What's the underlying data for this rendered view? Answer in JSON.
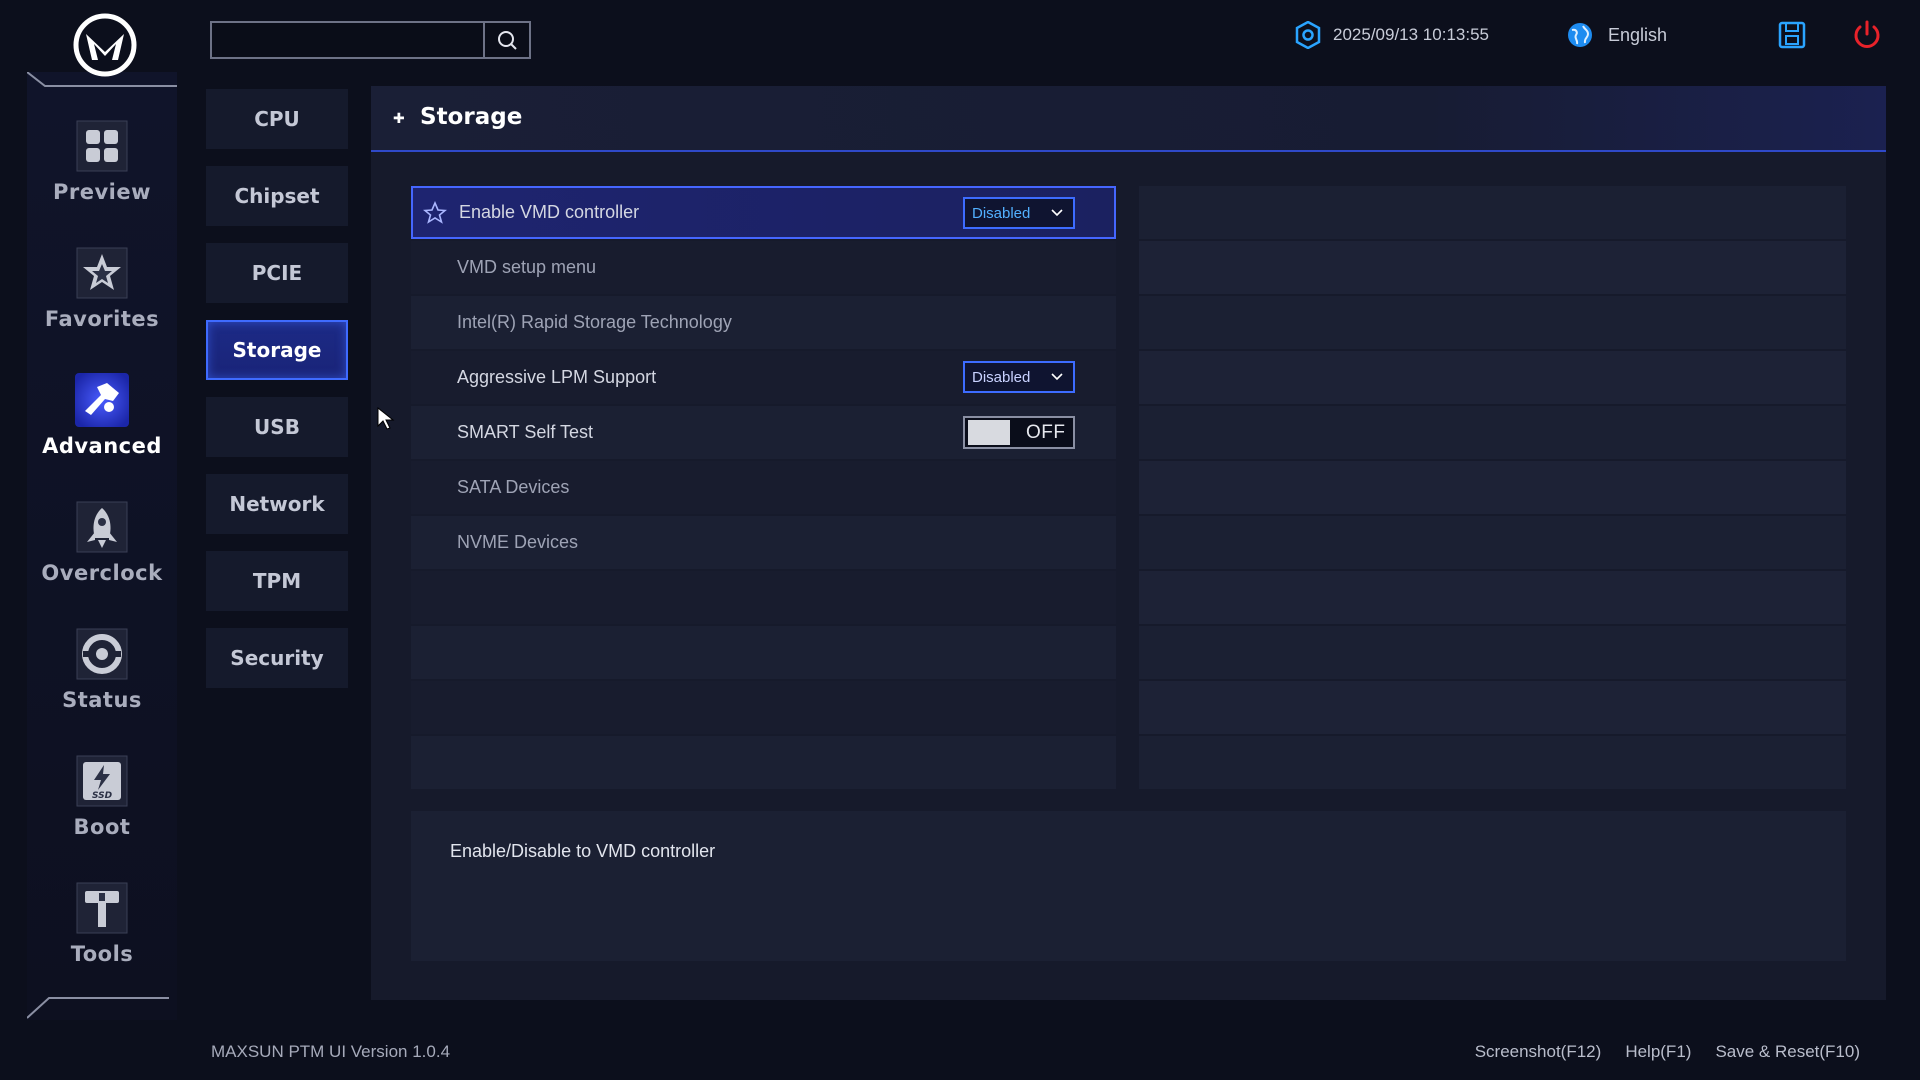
{
  "app": {
    "version": "MAXSUN PTM UI Version 1.0.4",
    "accent": "#3f6bff",
    "datetime": "2025/09/13 10:13:55",
    "language": "English"
  },
  "search": {
    "value": "",
    "placeholder": ""
  },
  "nav": {
    "items": [
      {
        "label": "Preview",
        "icon": "grid-icon"
      },
      {
        "label": "Favorites",
        "icon": "star-icon"
      },
      {
        "label": "Advanced",
        "icon": "advanced-icon",
        "active": true
      },
      {
        "label": "Overclock",
        "icon": "rocket-icon"
      },
      {
        "label": "Status",
        "icon": "status-icon"
      },
      {
        "label": "Boot",
        "icon": "ssd-icon"
      },
      {
        "label": "Tools",
        "icon": "hammer-icon"
      }
    ]
  },
  "subtabs": [
    {
      "label": "CPU"
    },
    {
      "label": "Chipset"
    },
    {
      "label": "PCIE"
    },
    {
      "label": "Storage",
      "active": true
    },
    {
      "label": "USB"
    },
    {
      "label": "Network"
    },
    {
      "label": "TPM"
    },
    {
      "label": "Security"
    }
  ],
  "panel": {
    "title": "Storage",
    "rows": [
      {
        "label": "Enable VMD controller",
        "type": "dropdown",
        "value": "Disabled",
        "selected": true
      },
      {
        "label": "VMD setup menu",
        "type": "link"
      },
      {
        "label": "Intel(R) Rapid Storage Technology",
        "type": "link"
      },
      {
        "label": "Aggressive LPM Support",
        "type": "dropdown",
        "value": "Disabled"
      },
      {
        "label": "SMART Self Test",
        "type": "toggle",
        "value": "OFF"
      },
      {
        "label": "SATA Devices",
        "type": "link"
      },
      {
        "label": "NVME Devices",
        "type": "link"
      }
    ],
    "help": "Enable/Disable to VMD controller"
  },
  "footer": {
    "screenshot": "Screenshot(F12)",
    "help": "Help(F1)",
    "save_reset": "Save & Reset(F10)"
  }
}
